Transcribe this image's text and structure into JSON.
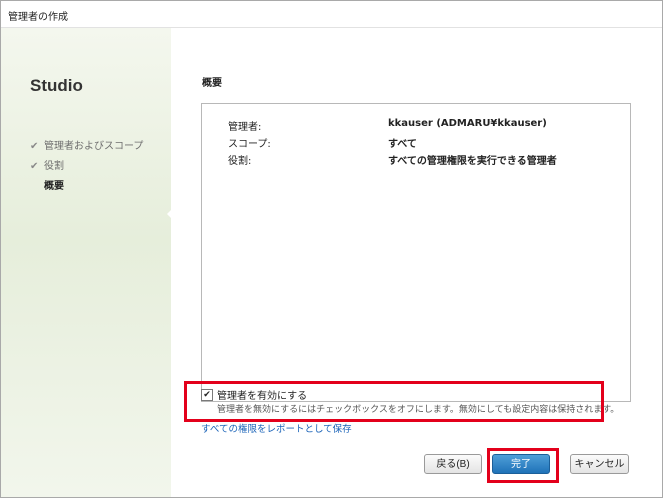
{
  "window": {
    "title": "管理者の作成"
  },
  "sidebar": {
    "brand": "Studio",
    "steps": [
      {
        "label": "管理者およびスコープ",
        "state": "done"
      },
      {
        "label": "役割",
        "state": "done"
      },
      {
        "label": "概要",
        "state": "current"
      }
    ]
  },
  "main": {
    "section_title": "概要",
    "summary": [
      {
        "key": "管理者:",
        "value": "kkauser (ADMARU¥kkauser)"
      },
      {
        "key": "スコープ:",
        "value": "すべて"
      },
      {
        "key": "役割:",
        "value": "すべての管理権限を実行できる管理者"
      }
    ],
    "enable": {
      "checked": true,
      "label": "管理者を有効にする",
      "description": "管理者を無効にするにはチェックボックスをオフにします。無効にしても設定内容は保持されます。"
    },
    "report_link": "すべての権限をレポートとして保存"
  },
  "buttons": {
    "back": "戻る(B)",
    "finish": "完了",
    "cancel": "キャンセル"
  },
  "colors": {
    "highlight": "#e3001b",
    "link": "#1a63b8",
    "primary_button": "#1f72b8"
  }
}
